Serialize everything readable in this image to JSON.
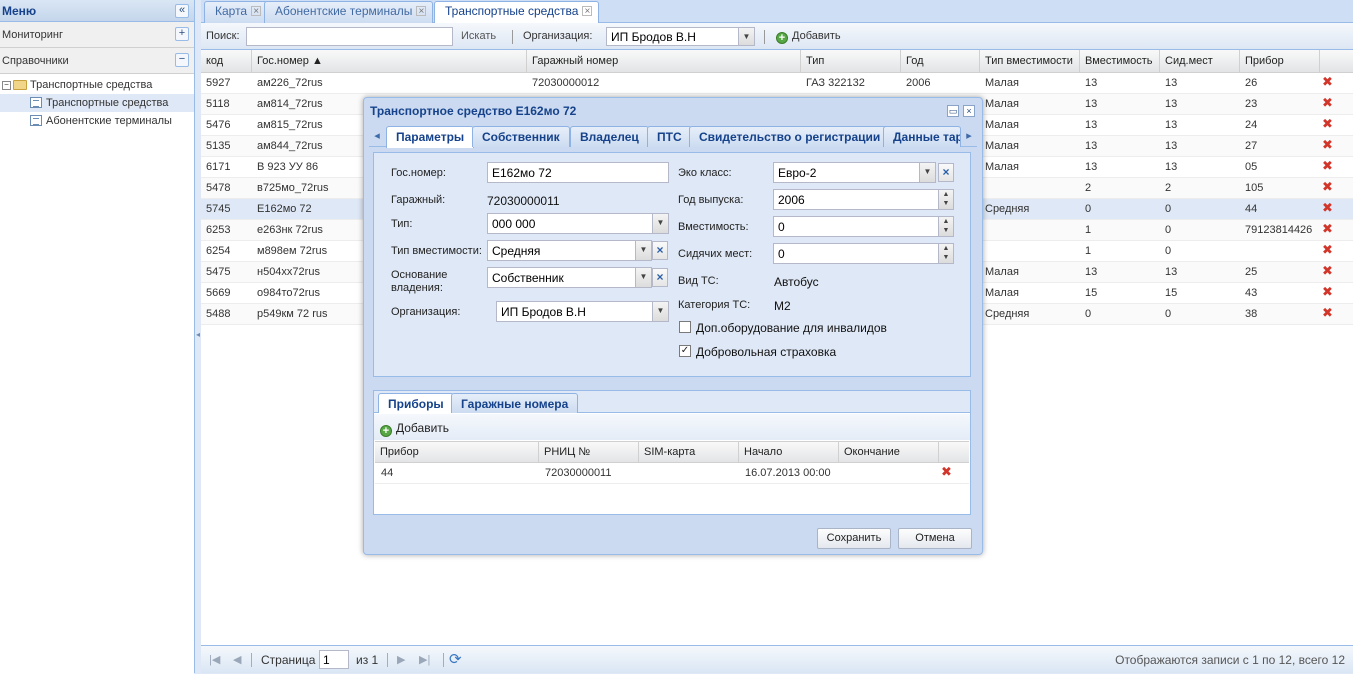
{
  "menu": {
    "title": "Меню",
    "collapse_icon": "«",
    "sections": [
      {
        "label": "Мониторинг",
        "toggle": "+"
      },
      {
        "label": "Справочники",
        "toggle": "−"
      }
    ],
    "tree": {
      "root": "Транспортные средства",
      "children": [
        "Транспортные средства",
        "Абонентские терминалы"
      ]
    }
  },
  "tabs": [
    {
      "label": "Карта"
    },
    {
      "label": "Абонентские терминалы"
    },
    {
      "label": "Транспортные средства"
    }
  ],
  "toolbar": {
    "search_label": "Поиск:",
    "search_value": "",
    "search_button": "Искать",
    "org_label": "Организация:",
    "org_value": "ИП Бродов В.Н",
    "add_label": "Добавить"
  },
  "grid": {
    "columns": [
      "код",
      "Гос.номер ▲",
      "Гаражный номер",
      "Тип",
      "Год",
      "Тип вместимости",
      "Вместимость",
      "Сид.мест",
      "Прибор"
    ],
    "rows": [
      {
        "kod": "5927",
        "gos": "ам226_72rus",
        "gar": "72030000012",
        "tip": "ГАЗ 322132",
        "god": "2006",
        "tv": "Малая",
        "vm": "13",
        "sid": "13",
        "pr": "26"
      },
      {
        "kod": "5118",
        "gos": "ам814_72rus",
        "gar": "",
        "tip": "",
        "god": "",
        "tv": "Малая",
        "vm": "13",
        "sid": "13",
        "pr": "23"
      },
      {
        "kod": "5476",
        "gos": "ам815_72rus",
        "gar": "",
        "tip": "",
        "god": "",
        "tv": "Малая",
        "vm": "13",
        "sid": "13",
        "pr": "24"
      },
      {
        "kod": "5135",
        "gos": "ам844_72rus",
        "gar": "",
        "tip": "",
        "god": "",
        "tv": "Малая",
        "vm": "13",
        "sid": "13",
        "pr": "27"
      },
      {
        "kod": "6171",
        "gos": "В 923 УУ 86",
        "gar": "",
        "tip": "",
        "god": "",
        "tv": "Малая",
        "vm": "13",
        "sid": "13",
        "pr": "05"
      },
      {
        "kod": "5478",
        "gos": "в725мо_72rus",
        "gar": "",
        "tip": "",
        "god": "",
        "tv": "",
        "vm": "2",
        "sid": "2",
        "pr": "105"
      },
      {
        "kod": "5745",
        "gos": "Е162мо 72",
        "gar": "",
        "tip": "",
        "god": "",
        "tv": "Средняя",
        "vm": "0",
        "sid": "0",
        "pr": "44"
      },
      {
        "kod": "6253",
        "gos": "е263нк 72rus",
        "gar": "",
        "tip": "",
        "god": "",
        "tv": "",
        "vm": "1",
        "sid": "0",
        "pr": "79123814426"
      },
      {
        "kod": "6254",
        "gos": "м898ем 72rus",
        "gar": "",
        "tip": "",
        "god": "",
        "tv": "",
        "vm": "1",
        "sid": "0",
        "pr": ""
      },
      {
        "kod": "5475",
        "gos": "н504хх72rus",
        "gar": "",
        "tip": "",
        "god": "",
        "tv": "Малая",
        "vm": "13",
        "sid": "13",
        "pr": "25"
      },
      {
        "kod": "5669",
        "gos": "о984то72rus",
        "gar": "",
        "tip": "",
        "god": "",
        "tv": "Малая",
        "vm": "15",
        "sid": "15",
        "pr": "43"
      },
      {
        "kod": "5488",
        "gos": "р549км 72 rus",
        "gar": "",
        "tip": "",
        "god": "",
        "tv": "Средняя",
        "vm": "0",
        "sid": "0",
        "pr": "38"
      }
    ]
  },
  "pager": {
    "page_label": "Страница",
    "page_value": "1",
    "of_label": "из 1",
    "status": "Отображаются записи с 1 по 12, всего 12"
  },
  "window": {
    "title": "Транспортное средство Е162мо 72",
    "tabs": [
      "Параметры",
      "Собственник",
      "Владелец",
      "ПТС",
      "Свидетельство о регистрации",
      "Данные тар"
    ],
    "form": {
      "gos_label": "Гос.номер:",
      "gos_value": "Е162мо 72",
      "gar_label": "Гаражный:",
      "gar_value": "72030000011",
      "tip_label": "Тип:",
      "tip_value": "000 000",
      "tv_label": "Тип вместимости:",
      "tv_value": "Средняя",
      "osn_label": "Основание владения:",
      "osn_value": "Собственник",
      "org_label": "Организация:",
      "org_value": "ИП Бродов В.Н",
      "eco_label": "Эко класс:",
      "eco_value": "Евро-2",
      "year_label": "Год выпуска:",
      "year_value": "2006",
      "cap_label": "Вместимость:",
      "cap_value": "0",
      "seats_label": "Сидячих мест:",
      "seats_value": "0",
      "vid_label": "Вид ТС:",
      "vid_value": "Автобус",
      "cat_label": "Категория ТС:",
      "cat_value": "М2",
      "cb1_label": "Доп.оборудование для инвалидов",
      "cb2_label": "Добровольная страховка"
    },
    "subtabs": [
      "Приборы",
      "Гаражные номера"
    ],
    "sub_add": "Добавить",
    "sub_columns": [
      "Прибор",
      "РНИЦ №",
      "SIM-карта",
      "Начало",
      "Окончание"
    ],
    "sub_row": {
      "pribor": "44",
      "rnic": "72030000011",
      "sim": "",
      "start": "16.07.2013 00:00",
      "end": ""
    },
    "save": "Сохранить",
    "cancel": "Отмена"
  }
}
